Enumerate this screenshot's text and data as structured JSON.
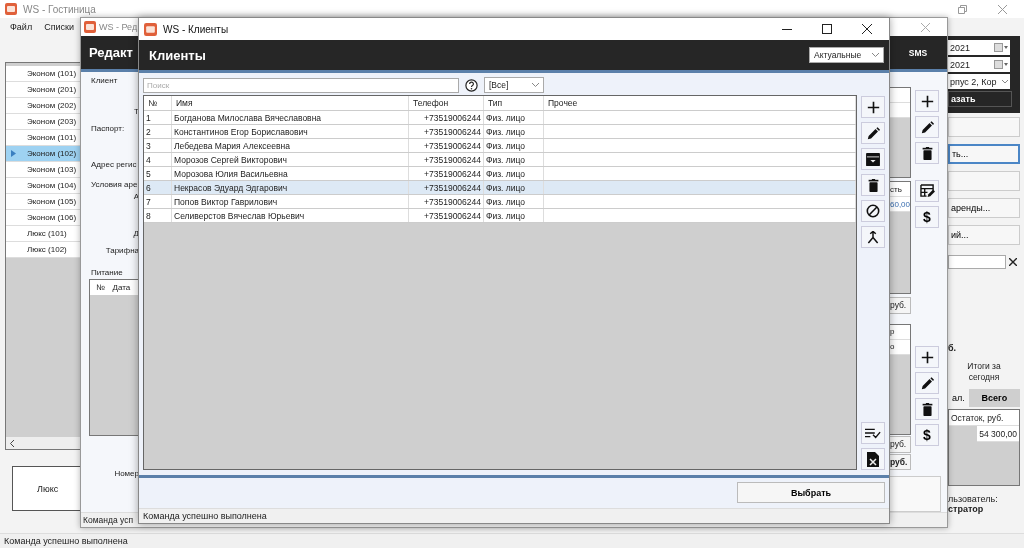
{
  "main_window": {
    "title": "WS - Гостиница",
    "menu": [
      {
        "label": "Файл"
      },
      {
        "label": "Списки"
      }
    ],
    "rooms": [
      {
        "label": "Эконом (101)",
        "selected": false
      },
      {
        "label": "Эконом (201)",
        "selected": false
      },
      {
        "label": "Эконом (202)",
        "selected": false
      },
      {
        "label": "Эконом (203)",
        "selected": false
      },
      {
        "label": "Эконом (101)",
        "selected": false
      },
      {
        "label": "Эконом (102)",
        "selected": true
      },
      {
        "label": "Эконом (103)",
        "selected": false
      },
      {
        "label": "Эконом (104)",
        "selected": false
      },
      {
        "label": "Эконом (105)",
        "selected": false
      },
      {
        "label": "Эконом (106)",
        "selected": false
      },
      {
        "label": "Люкс (101)",
        "selected": false
      },
      {
        "label": "Люкс (102)",
        "selected": false
      }
    ],
    "room_type": "Люкс",
    "dates": [
      {
        "value": "2021"
      },
      {
        "value": "2021"
      }
    ],
    "building": "рпус 2, Кор",
    "show_button": "азать",
    "actions": [
      {
        "focused": false
      },
      {
        "label": "ть...",
        "focused": true
      },
      {
        "focused": false
      },
      {
        "label": "аренды...",
        "focused": false
      },
      {
        "label": "ий...",
        "focused": false
      }
    ],
    "amount_fragment": "б.",
    "totals_caption": "Итоги за сегодня",
    "totals_tabs": [
      {
        "label": "ал.",
        "selected": false
      },
      {
        "label": "Всего",
        "selected": true
      }
    ],
    "totals_table": {
      "columns": [
        "Остаток, руб."
      ],
      "rows": [
        [
          "54 300,00"
        ]
      ]
    },
    "user_label": "льзователь:",
    "user_name": "стратор",
    "status": "Команда успешно выполнена"
  },
  "editor_window": {
    "title": "WS - Ред",
    "header": "Редакт",
    "sms": "SMS",
    "client_label": "Клиент",
    "t_fragment": "Т",
    "passport_label": "Паспорт:",
    "address_label": "Адрес регис",
    "terms_label": "Условия аре",
    "a_fragment": "А",
    "d_fragment": "Д",
    "tariff_label": "Тарифна",
    "meals": {
      "label": "Питание",
      "columns": [
        "№",
        "Дата"
      ]
    },
    "room_label": "Номер",
    "payments_table": {
      "columns": [
        "сть"
      ],
      "rows": [
        [
          "60,00"
        ]
      ]
    },
    "services_table": {
      "rows": [
        [
          "р"
        ],
        [
          "о"
        ]
      ]
    },
    "sums": [
      {
        "text": "руб.",
        "bold": false
      },
      {
        "text": "руб.",
        "bold": false
      },
      {
        "text": "руб.",
        "bold": true
      }
    ],
    "tool_groups": [
      [
        {
          "kind": "add"
        },
        {
          "kind": "edit"
        },
        {
          "kind": "delete"
        }
      ],
      [
        {
          "kind": "table-edit"
        },
        {
          "kind": "payment",
          "label": "$"
        }
      ],
      [
        {
          "kind": "add"
        },
        {
          "kind": "edit"
        },
        {
          "kind": "delete"
        },
        {
          "kind": "payment",
          "label": "$"
        }
      ]
    ],
    "status": "Команда усп"
  },
  "clients_window": {
    "title": "WS - Клиенты",
    "header": "Клиенты",
    "filter": "Актуальные",
    "search": {
      "placeholder": "Поиск"
    },
    "type_filter": "[Все]",
    "table": {
      "columns": [
        "№",
        "Имя",
        "Телефон",
        "Тип",
        "Прочее"
      ],
      "rows": [
        {
          "cells": [
            "1",
            "Богданова Милослава Вячеславовна",
            "+73519006244",
            "Физ. лицо"
          ],
          "selected": false
        },
        {
          "cells": [
            "2",
            "Константинов Егор Бориславович",
            "+73519006244",
            "Физ. лицо"
          ],
          "selected": false
        },
        {
          "cells": [
            "3",
            "Лебедева Мария Алексеевна",
            "+73519006244",
            "Физ. лицо"
          ],
          "selected": false
        },
        {
          "cells": [
            "4",
            "Морозов Сергей Викторович",
            "+73519006244",
            "Физ. лицо"
          ],
          "selected": false
        },
        {
          "cells": [
            "5",
            "Морозова Юлия Васильевна",
            "+73519006244",
            "Физ. лицо"
          ],
          "selected": false
        },
        {
          "cells": [
            "6",
            "Некрасов Эдуард Эдгарович",
            "+73519006244",
            "Физ. лицо"
          ],
          "selected": true
        },
        {
          "cells": [
            "7",
            "Попов Виктор Гаврилович",
            "+73519006244",
            "Физ. лицо"
          ],
          "selected": false
        },
        {
          "cells": [
            "8",
            "Селиверстов Вячеслав Юрьевич",
            "+73519006244",
            "Физ. лицо"
          ],
          "selected": false
        }
      ]
    },
    "side_buttons": [
      {
        "kind": "add"
      },
      {
        "kind": "edit"
      },
      {
        "kind": "archive"
      },
      {
        "kind": "delete"
      },
      {
        "kind": "block"
      },
      {
        "kind": "merge"
      }
    ],
    "bottom_buttons": [
      {
        "kind": "check-list"
      },
      {
        "kind": "document"
      }
    ],
    "select_button": "Выбрать",
    "status": "Команда успешно выполнена"
  }
}
